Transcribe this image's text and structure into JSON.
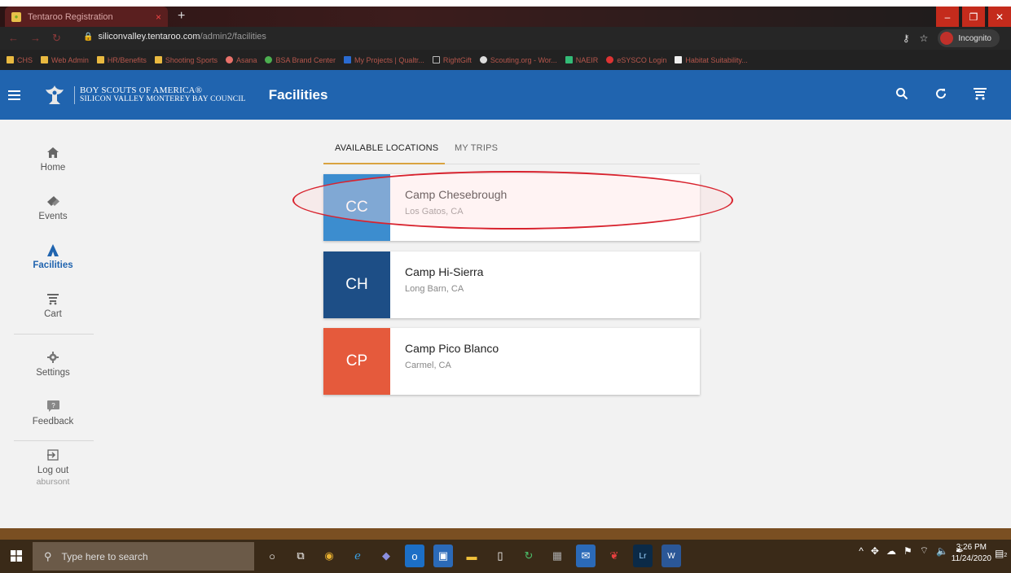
{
  "browser": {
    "tab_title": "Tentaroo Registration",
    "tab_close": "×",
    "new_tab": "+",
    "url_host": "siliconvalley.tentaroo.com",
    "url_path": "/admin2/facilities",
    "incognito_label": "Incognito",
    "window_controls": [
      "–",
      "❐",
      "✕"
    ],
    "bookmarks": [
      "CHS",
      "Web Admin",
      "HR/Benefits",
      "Shooting Sports",
      "Asana",
      "BSA Brand Center",
      "My Projects | Qualtr...",
      "RightGift",
      "Scouting.org - Wor...",
      "NAEIR",
      "eSYSCO Login",
      "Habitat Suitability..."
    ]
  },
  "appbar": {
    "org_line1": "BOY SCOUTS OF AMERICA®",
    "org_line2": "SILICON VALLEY MONTEREY BAY COUNCIL",
    "title": "Facilities",
    "color": "#2064af"
  },
  "sidebar": {
    "items": [
      {
        "label": "Home",
        "icon": "home-icon"
      },
      {
        "label": "Events",
        "icon": "tickets-icon"
      },
      {
        "label": "Facilities",
        "icon": "tent-icon",
        "active": true
      },
      {
        "label": "Cart",
        "icon": "cart-icon"
      },
      {
        "label": "Settings",
        "icon": "gear-icon"
      },
      {
        "label": "Feedback",
        "icon": "feedback-icon"
      },
      {
        "label": "Log out",
        "icon": "logout-icon",
        "sub": "abursont"
      }
    ]
  },
  "tabs": {
    "available": "AVAILABLE LOCATIONS",
    "trips": "MY TRIPS"
  },
  "locations": [
    {
      "initials": "CC",
      "name": "Camp Chesebrough",
      "place": "Los Gatos, CA",
      "color": "#3c8dcf"
    },
    {
      "initials": "CH",
      "name": "Camp Hi-Sierra",
      "place": "Long Barn, CA",
      "color": "#1d4e86"
    },
    {
      "initials": "CP",
      "name": "Camp Pico Blanco",
      "place": "Carmel, CA",
      "color": "#e55a3c"
    }
  ],
  "taskbar": {
    "search_placeholder": "Type here to search",
    "time": "3:26 PM",
    "date": "11/24/2020",
    "notif_count": "2"
  }
}
